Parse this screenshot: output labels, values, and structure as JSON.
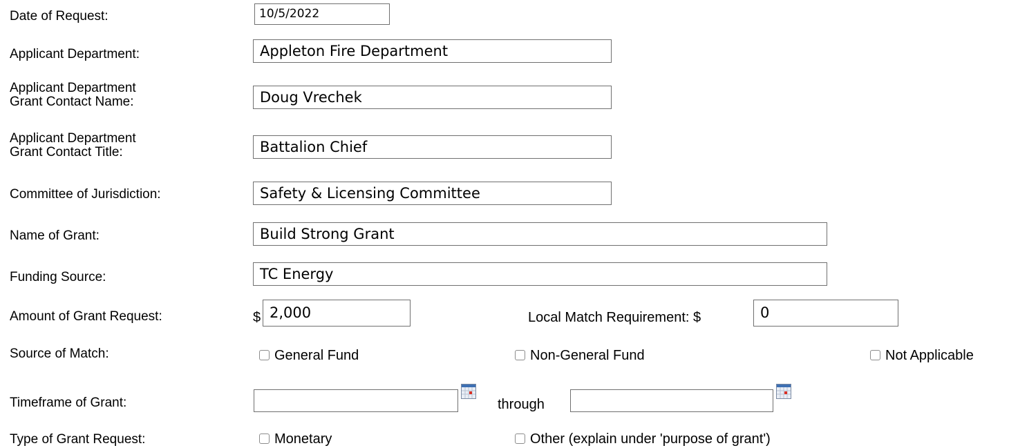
{
  "form": {
    "date_of_request": {
      "label": "Date of Request:",
      "value": "10/5/2022"
    },
    "applicant_department": {
      "label": "Applicant Department:",
      "value": "Appleton Fire Department"
    },
    "contact_name": {
      "label_line1": "Applicant Department",
      "label_line2": "Grant Contact Name:",
      "value": "Doug Vrechek"
    },
    "contact_title": {
      "label_line1": "Applicant Department",
      "label_line2": "Grant Contact Title:",
      "value": "Battalion Chief"
    },
    "committee": {
      "label": "Committee of Jurisdiction:",
      "value": "Safety & Licensing Committee"
    },
    "grant_name": {
      "label": "Name of Grant:",
      "value": "Build Strong Grant"
    },
    "funding_source": {
      "label": "Funding Source:",
      "value": "TC Energy"
    },
    "amount": {
      "label": "Amount of Grant Request:",
      "currency": "$",
      "value": "2,000"
    },
    "local_match": {
      "label": "Local Match Requirement: $",
      "value": "0"
    },
    "source_of_match": {
      "label": "Source of Match:",
      "options": [
        "General Fund",
        "Non-General Fund",
        "Not Applicable"
      ]
    },
    "timeframe": {
      "label": "Timeframe of Grant:",
      "through": "through",
      "start_value": "",
      "end_value": ""
    },
    "grant_type": {
      "label": "Type of Grant Request:",
      "options": [
        "Monetary",
        "Other (explain under 'purpose of grant')"
      ]
    }
  }
}
